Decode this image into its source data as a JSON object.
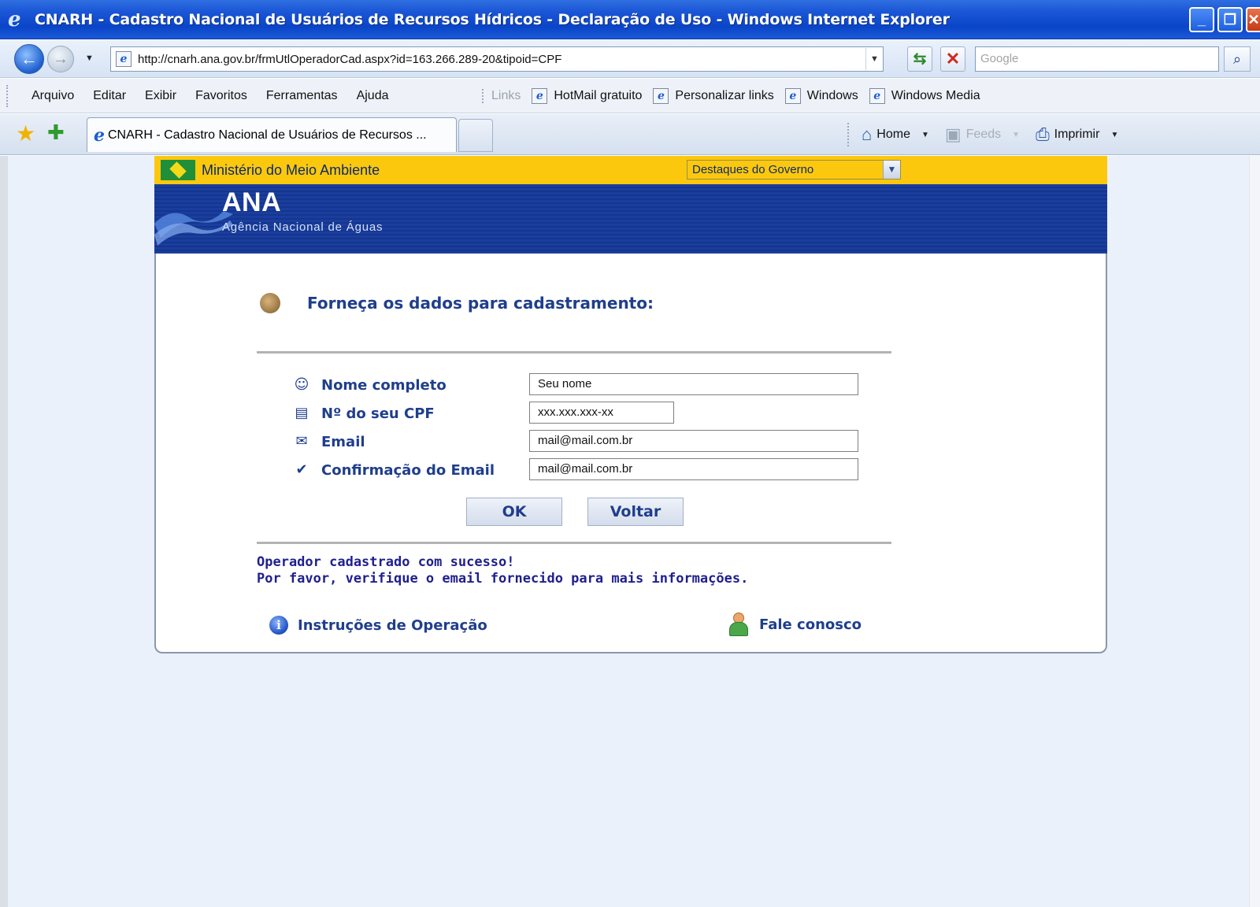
{
  "window": {
    "title": "CNARH - Cadastro Nacional de Usuários de Recursos Hídricos - Declaração de Uso - Windows Internet Explorer",
    "buttons": {
      "minimize": "_",
      "restore": "❐",
      "close": "✕"
    }
  },
  "address_bar": {
    "url": "http://cnarh.ana.gov.br/frmUtlOperadorCad.aspx?id=163.266.289-20&tipoid=CPF",
    "search_placeholder": "Google"
  },
  "menu": {
    "items": [
      "Arquivo",
      "Editar",
      "Exibir",
      "Favoritos",
      "Ferramentas",
      "Ajuda"
    ]
  },
  "links_bar": {
    "label": "Links",
    "items": [
      "HotMail gratuito",
      "Personalizar links",
      "Windows",
      "Windows Media"
    ]
  },
  "tabs": {
    "active": "CNARH - Cadastro Nacional de Usuários de Recursos ..."
  },
  "command_bar": {
    "home": "Home",
    "feeds": "Feeds",
    "print": "Imprimir"
  },
  "gov_bar": {
    "ministry": "Ministério do Meio Ambiente",
    "select_value": "Destaques do Governo",
    "color": "#fcc80e"
  },
  "banner": {
    "logo": "ANA",
    "subtitle": "Agência Nacional de Águas",
    "color": "#1a3e9e"
  },
  "form": {
    "heading": "Forneça os dados para cadastramento:",
    "fields": [
      {
        "label": "Nome completo",
        "value": "Seu nome",
        "icon": "person-icon"
      },
      {
        "label": "Nº do seu CPF",
        "value": "xxx.xxx.xxx-xx",
        "icon": "id-card-icon"
      },
      {
        "label": "Email",
        "value": "mail@mail.com.br",
        "icon": "envelope-icon"
      },
      {
        "label": "Confirmação do Email",
        "value": "mail@mail.com.br",
        "icon": "checkmark-icon"
      }
    ],
    "ok_label": "OK",
    "back_label": "Voltar"
  },
  "message": {
    "line1": "Operador cadastrado com sucesso!",
    "line2": "Por favor, verifique o email fornecido para mais informações."
  },
  "footer": {
    "instructions": "Instruções de Operação",
    "contact": "Fale conosco"
  },
  "colors": {
    "heading_text": "#1f3e8c",
    "message_text": "#1f1f8e",
    "page_background": "#ebf1fa"
  }
}
